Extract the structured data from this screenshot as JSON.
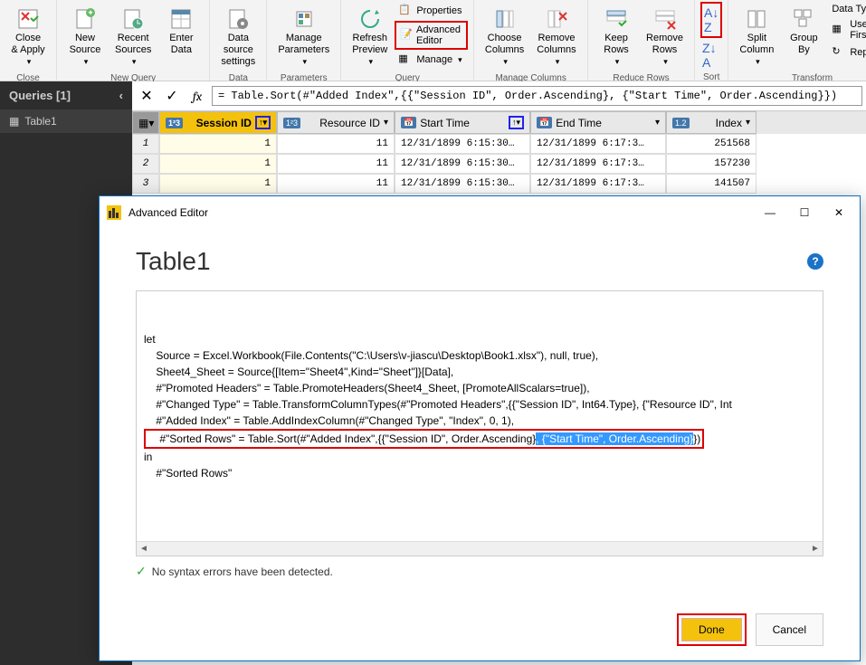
{
  "ribbon": {
    "close_apply": "Close &\nApply",
    "close_group": "Close",
    "new_source": "New\nSource",
    "recent_sources": "Recent\nSources",
    "enter_data": "Enter\nData",
    "new_query_group": "New Query",
    "data_source_settings": "Data source\nsettings",
    "data_sources_group": "Data Sources",
    "manage_parameters": "Manage\nParameters",
    "parameters_group": "Parameters",
    "refresh_preview": "Refresh\nPreview",
    "properties": "Properties",
    "advanced_editor": "Advanced Editor",
    "manage": "Manage",
    "query_group": "Query",
    "choose_columns": "Choose\nColumns",
    "remove_columns": "Remove\nColumns",
    "manage_columns_group": "Manage Columns",
    "keep_rows": "Keep\nRows",
    "remove_rows": "Remove\nRows",
    "reduce_rows_group": "Reduce Rows",
    "sort_group": "Sort",
    "split_column": "Split\nColumn",
    "group_by": "Group\nBy",
    "data_type": "Data Type:",
    "use_first": "Use Firs",
    "replace": "Replace",
    "transform_group": "Transform"
  },
  "sidebar": {
    "title": "Queries [1]",
    "items": [
      {
        "label": "Table1"
      }
    ]
  },
  "formula": "= Table.Sort(#\"Added Index\",{{\"Session ID\", Order.Ascending}, {\"Start Time\", Order.Ascending}})",
  "table": {
    "columns": [
      {
        "type": "1²3",
        "name": "Session ID"
      },
      {
        "type": "1²3",
        "name": "Resource ID"
      },
      {
        "type": "📅",
        "name": "Start Time"
      },
      {
        "type": "📅",
        "name": "End Time"
      },
      {
        "type": "1.2",
        "name": "Index"
      }
    ],
    "rows": [
      {
        "n": "1",
        "session": "1",
        "resource": "11",
        "start": "12/31/1899 6:15:30…",
        "end": "12/31/1899 6:17:3…",
        "index": "251568"
      },
      {
        "n": "2",
        "session": "1",
        "resource": "11",
        "start": "12/31/1899 6:15:30…",
        "end": "12/31/1899 6:17:3…",
        "index": "157230"
      },
      {
        "n": "3",
        "session": "1",
        "resource": "11",
        "start": "12/31/1899 6:15:30…",
        "end": "12/31/1899 6:17:3…",
        "index": "141507"
      }
    ]
  },
  "modal": {
    "title": "Advanced Editor",
    "heading": "Table1",
    "code_lines": [
      "let",
      "    Source = Excel.Workbook(File.Contents(\"C:\\Users\\v-jiascu\\Desktop\\Book1.xlsx\"), null, true),",
      "    Sheet4_Sheet = Source{[Item=\"Sheet4\",Kind=\"Sheet\"]}[Data],",
      "    #\"Promoted Headers\" = Table.PromoteHeaders(Sheet4_Sheet, [PromoteAllScalars=true]),",
      "    #\"Changed Type\" = Table.TransformColumnTypes(#\"Promoted Headers\",{{\"Session ID\", Int64.Type}, {\"Resource ID\", Int",
      "    #\"Added Index\" = Table.AddIndexColumn(#\"Changed Type\", \"Index\", 0, 1),"
    ],
    "sorted_prefix": "    #\"Sorted Rows\" = Table.Sort(#\"Added Index\",{{\"Session ID\", Order.Ascending}",
    "sorted_selected": ", {\"Start Time\", Order.Ascending}",
    "sorted_suffix": "})",
    "code_tail": [
      "in",
      "    #\"Sorted Rows\""
    ],
    "status": "No syntax errors have been detected.",
    "done": "Done",
    "cancel": "Cancel"
  }
}
